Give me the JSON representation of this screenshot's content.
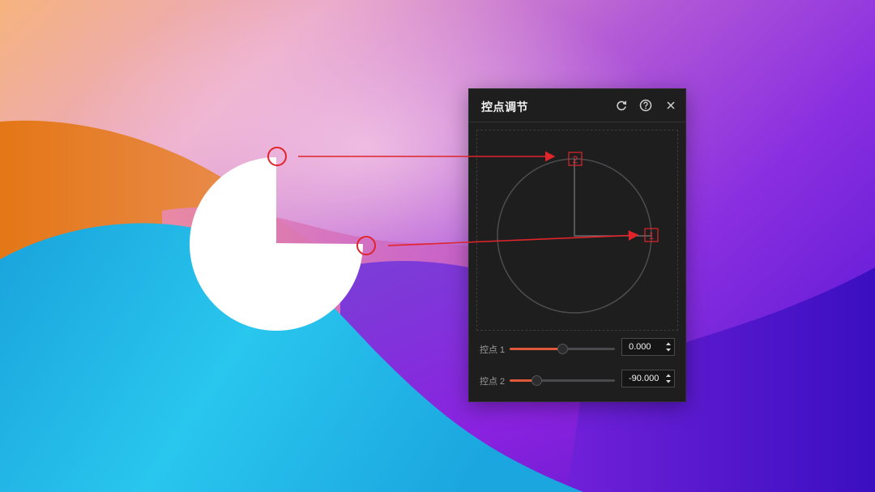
{
  "panel": {
    "title": "控点调节",
    "refresh_icon": "refresh-icon",
    "help_icon": "help-icon",
    "close_icon": "close-icon"
  },
  "canvas": {
    "marker_1": "1",
    "marker_2": "2"
  },
  "controls": [
    {
      "label": "控点 1",
      "value": "0.000",
      "slider_fraction": 0.5
    },
    {
      "label": "控点 2",
      "value": "-90.000",
      "slider_fraction": 0.25
    }
  ],
  "colors": {
    "accent": "#e0583a",
    "annotation": "#e0242a",
    "panel_bg": "#1e1e1f"
  }
}
